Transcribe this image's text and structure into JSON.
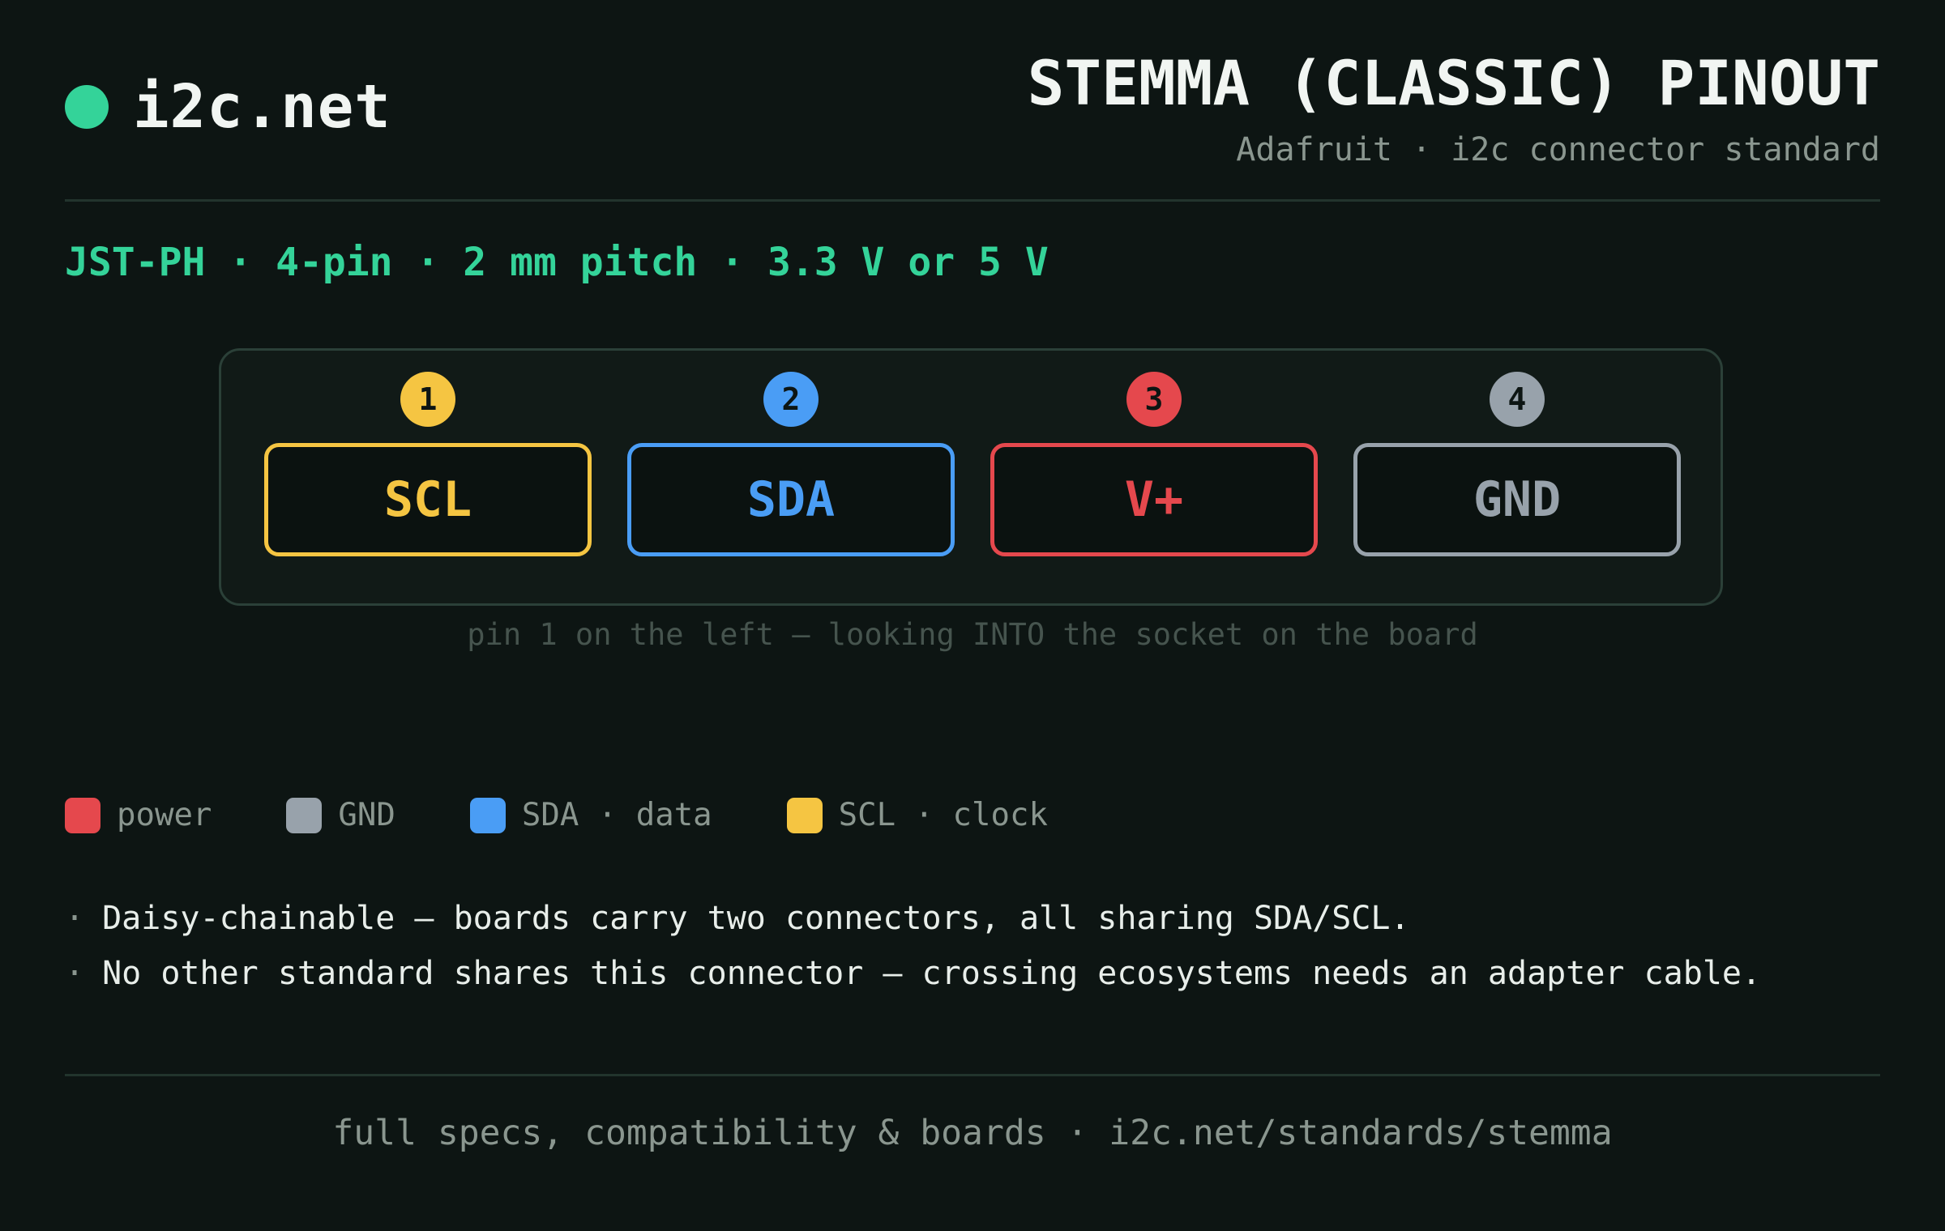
{
  "brand": {
    "name": "i2c.net",
    "dot_color": "#34d399"
  },
  "header": {
    "title": "STEMMA (CLASSIC) PINOUT",
    "subtitle": "Adafruit · i2c connector standard"
  },
  "spec_line": "JST-PH · 4-pin · 2 mm pitch · 3.3 V or 5 V",
  "connector": {
    "pins": [
      {
        "number": "1",
        "label": "SCL",
        "color": "#f5c542"
      },
      {
        "number": "2",
        "label": "SDA",
        "color": "#4a9df5"
      },
      {
        "number": "3",
        "label": "V+",
        "color": "#e5484d"
      },
      {
        "number": "4",
        "label": "GND",
        "color": "#98a2ab"
      }
    ],
    "caption": "pin 1 on the left — looking INTO the socket on the board"
  },
  "legend": [
    {
      "label": "power",
      "color": "#e5484d"
    },
    {
      "label": "GND",
      "color": "#98a2ab"
    },
    {
      "label": "SDA · data",
      "color": "#4a9df5"
    },
    {
      "label": "SCL · clock",
      "color": "#f5c542"
    }
  ],
  "notes": [
    {
      "bullet": "·",
      "text": "Daisy-chainable — boards carry two connectors, all sharing SDA/SCL."
    },
    {
      "bullet": "·",
      "text": "No other standard shares this connector — crossing ecosystems needs an adapter cable."
    }
  ],
  "footer": "full specs, compatibility & boards · i2c.net/standards/stemma"
}
